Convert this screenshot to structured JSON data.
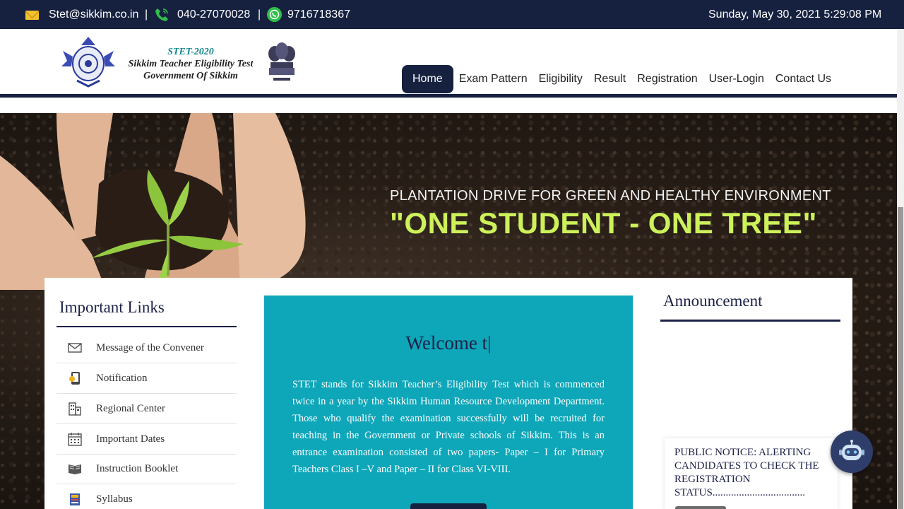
{
  "topbar": {
    "email": "Stet@sikkim.co.in",
    "separator": "|",
    "phone": "040-27070028",
    "whatsapp": "9716718367",
    "datetime": "Sunday, May 30, 2021 5:29:08 PM"
  },
  "logo": {
    "line1": "STET-2020",
    "line2": "Sikkim Teacher Eligibility Test",
    "line3": "Government Of Sikkim"
  },
  "nav": {
    "items": [
      "Home",
      "Exam Pattern",
      "Eligibility",
      "Result",
      "Registration",
      "User-Login",
      "Contact Us"
    ],
    "active": "Home"
  },
  "banner": {
    "line1": "PLANTATION DRIVE FOR GREEN AND HEALTHY ENVIRONMENT",
    "line2": "\"ONE STUDENT - ONE TREE\""
  },
  "important_links": {
    "title": "Important Links",
    "items": [
      {
        "label": "Message of the Convener",
        "icon": "envelope-icon"
      },
      {
        "label": "Notification",
        "icon": "notification-icon"
      },
      {
        "label": "Regional Center",
        "icon": "building-icon"
      },
      {
        "label": "Important Dates",
        "icon": "calendar-icon"
      },
      {
        "label": "Instruction Booklet",
        "icon": "book-icon"
      },
      {
        "label": "Syllabus",
        "icon": "syllabus-icon"
      }
    ]
  },
  "welcome": {
    "title": "Welcome t|",
    "text": "STET stands for Sikkim Teacher’s Eligibility Test which is commenced twice in a year by the Sikkim Human Resource Development Department. Those who qualify the examination successfully will be recruited for teaching in the Government or Private schools of Sikkim. This is an entrance examination consisted of two papers- Paper – I for Primary Teachers Class I –V and Paper – II for Class VI-VIII."
  },
  "announcement": {
    "title": "Announcement",
    "notice": "PUBLIC NOTICE: ALERTING CANDIDATES TO CHECK THE REGISTRATION STATUS..................................."
  },
  "colors": {
    "navy": "#16213f",
    "teal": "#0ea6b9",
    "banner_green": "#cdf15a"
  }
}
